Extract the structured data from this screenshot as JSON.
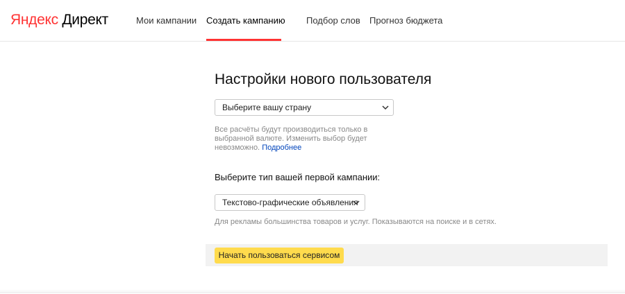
{
  "header": {
    "logo_yandex": "Яндекс",
    "logo_product": "Директ",
    "nav": [
      {
        "label": "Мои кампании"
      },
      {
        "label": "Создать кампанию"
      },
      {
        "label": "Подбор слов"
      },
      {
        "label": "Прогноз бюджета"
      }
    ],
    "active_tab": "Создать кампанию"
  },
  "form": {
    "title": "Настройки нового пользователя",
    "country_select": {
      "value": "Выберите вашу страну"
    },
    "currency_hint": {
      "lines": [
        "Все расчёты будут производиться только в",
        "выбранной валюте. Изменить выбор будет"
      ],
      "last_line_text": "невозможно.",
      "link": "Подробнее"
    },
    "campaign_type_label": "Выберите тип вашей первой кампании:",
    "campaign_type_select": {
      "value": "Текстово-графические объявления"
    },
    "campaign_type_hint": "Для рекламы большинства товаров и услуг. Показываются на поиске и в сетях.",
    "submit_label": "Начать пользоваться сервисом"
  },
  "colors": {
    "accent_red": "#ff3333",
    "button_yellow": "#ffdb4d",
    "link_blue": "#0044bb"
  },
  "icons": [
    "chevron-down-icon"
  ]
}
